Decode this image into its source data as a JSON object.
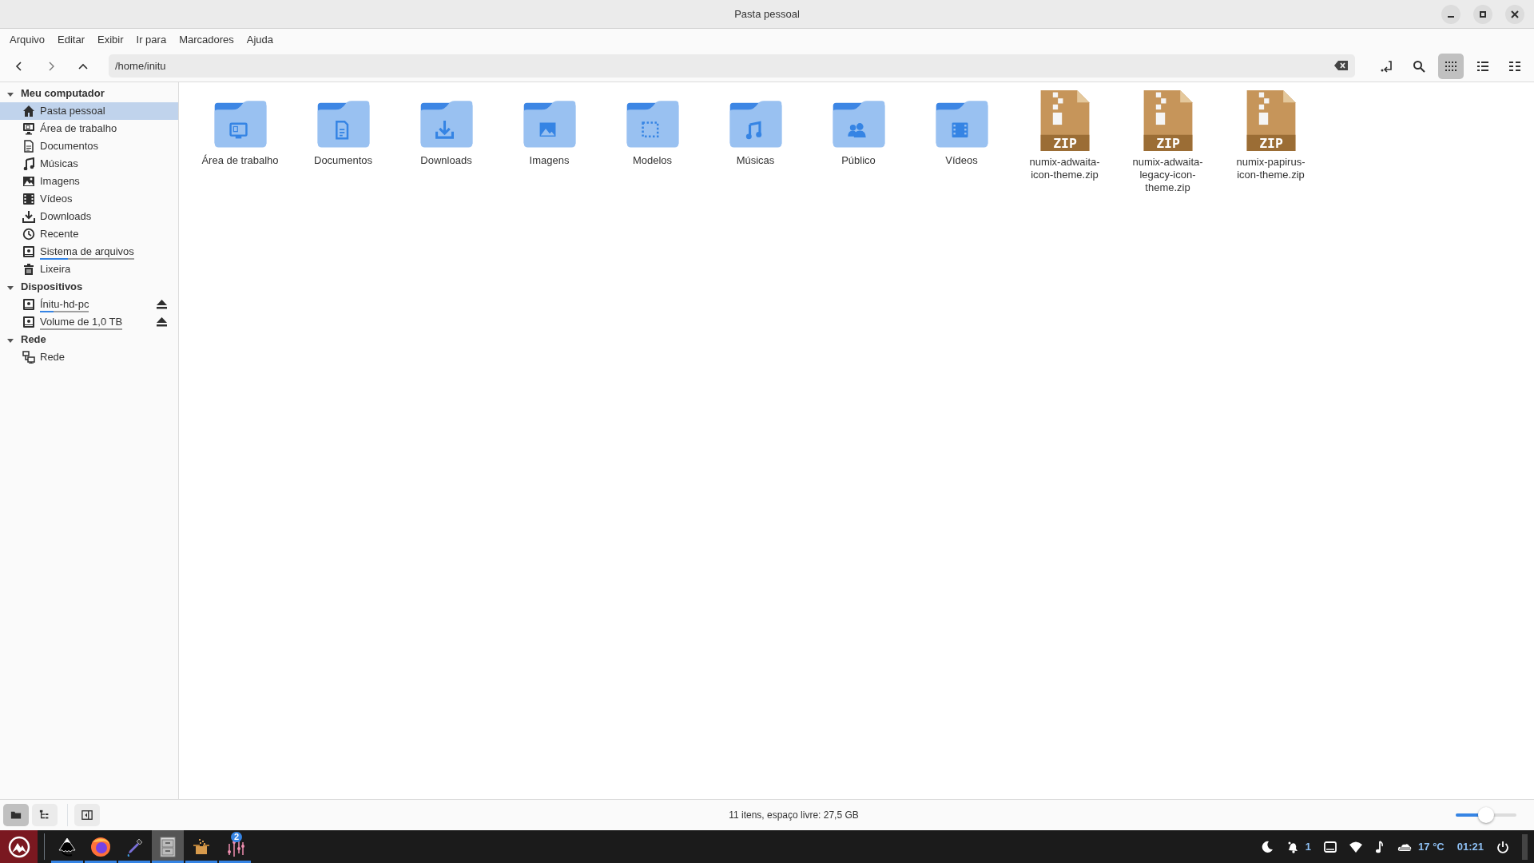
{
  "window": {
    "title": "Pasta pessoal"
  },
  "menu": [
    "Arquivo",
    "Editar",
    "Exibir",
    "Ir para",
    "Marcadores",
    "Ajuda"
  ],
  "location": {
    "value": "/home/initu"
  },
  "view_modes": [
    {
      "selected": true
    },
    {
      "selected": false
    },
    {
      "selected": false
    }
  ],
  "sidebar": [
    {
      "label": "Meu computador",
      "expanded": true,
      "children": [
        {
          "label": "Pasta pessoal",
          "selected": true
        },
        {
          "label": "Área de trabalho",
          "selected": false
        },
        {
          "label": "Documentos",
          "selected": false
        },
        {
          "label": "Músicas",
          "selected": false
        },
        {
          "label": "Imagens",
          "selected": false
        },
        {
          "label": "Vídeos",
          "selected": false
        },
        {
          "label": "Downloads",
          "selected": false
        },
        {
          "label": "Recente",
          "selected": false
        },
        {
          "label": "Sistema de arquivos",
          "selected": false,
          "level": 0.3
        },
        {
          "label": "Lixeira",
          "selected": false
        }
      ]
    },
    {
      "label": "Dispositivos",
      "expanded": true,
      "children": [
        {
          "label": "Ínitu-hd-pc",
          "selected": false,
          "level": 0.27,
          "ejectable": true
        },
        {
          "label": "Volume de 1,0 TB",
          "selected": false,
          "level": 0.0,
          "ejectable": true
        }
      ]
    },
    {
      "label": "Rede",
      "expanded": true,
      "children": [
        {
          "label": "Rede",
          "selected": false
        }
      ]
    }
  ],
  "files": [
    {
      "kind": "folder",
      "name": "Área de trabalho"
    },
    {
      "kind": "folder",
      "name": "Documentos"
    },
    {
      "kind": "folder",
      "name": "Downloads"
    },
    {
      "kind": "folder",
      "name": "Imagens"
    },
    {
      "kind": "folder",
      "name": "Modelos"
    },
    {
      "kind": "folder",
      "name": "Músicas"
    },
    {
      "kind": "folder",
      "name": "Público"
    },
    {
      "kind": "folder",
      "name": "Vídeos"
    },
    {
      "kind": "archive",
      "name": "numix-adwaita-icon-theme.zip",
      "icon_text": "ZIP"
    },
    {
      "kind": "archive",
      "name": "numix-adwaita-legacy-icon-theme.zip",
      "icon_text": "ZIP"
    },
    {
      "kind": "archive",
      "name": "numix-papirus-icon-theme.zip",
      "icon_text": "ZIP"
    }
  ],
  "side_pane_modes": [
    {
      "selected": true
    },
    {
      "selected": false
    }
  ],
  "status_bar": {
    "text": "11 itens, espaço livre: 27,5 GB",
    "zoom": {
      "level": 0.5
    }
  },
  "taskbar": {
    "launchers": [
      {
        "selected": false,
        "running": true
      },
      {
        "selected": false,
        "running": true
      },
      {
        "selected": false,
        "running": true
      },
      {
        "selected": true,
        "running": true
      },
      {
        "selected": false,
        "running": true
      },
      {
        "selected": false,
        "running": true,
        "badge": "2"
      }
    ],
    "notifications": "1",
    "temperature": "17 °C",
    "clock": "01:21"
  }
}
